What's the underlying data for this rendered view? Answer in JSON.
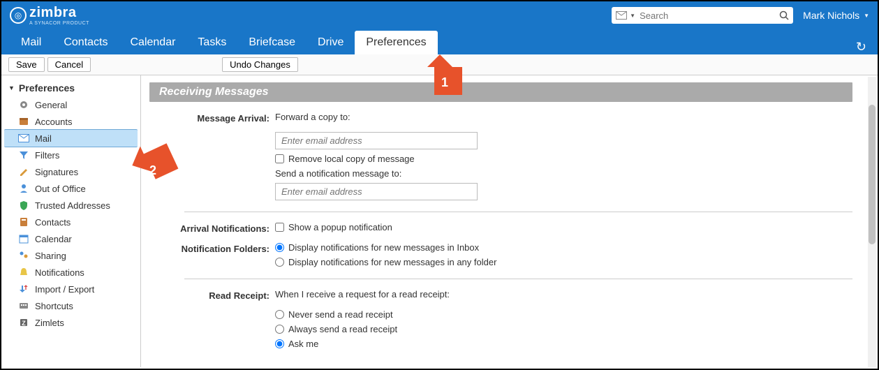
{
  "brand": {
    "name": "zimbra",
    "tagline": "A SYNACOR PRODUCT"
  },
  "search": {
    "placeholder": "Search"
  },
  "user": {
    "name": "Mark Nichols"
  },
  "nav": {
    "items": [
      "Mail",
      "Contacts",
      "Calendar",
      "Tasks",
      "Briefcase",
      "Drive",
      "Preferences"
    ],
    "active": "Preferences"
  },
  "toolbar": {
    "save": "Save",
    "cancel": "Cancel",
    "undo": "Undo Changes"
  },
  "sidebar": {
    "title": "Preferences",
    "items": [
      {
        "icon": "gear",
        "label": "General"
      },
      {
        "icon": "accounts",
        "label": "Accounts"
      },
      {
        "icon": "mail",
        "label": "Mail",
        "selected": true
      },
      {
        "icon": "filters",
        "label": "Filters"
      },
      {
        "icon": "signatures",
        "label": "Signatures"
      },
      {
        "icon": "outofoffice",
        "label": "Out of Office"
      },
      {
        "icon": "trusted",
        "label": "Trusted Addresses"
      },
      {
        "icon": "contacts",
        "label": "Contacts"
      },
      {
        "icon": "calendar",
        "label": "Calendar"
      },
      {
        "icon": "sharing",
        "label": "Sharing"
      },
      {
        "icon": "notifications",
        "label": "Notifications"
      },
      {
        "icon": "importexport",
        "label": "Import / Export"
      },
      {
        "icon": "shortcuts",
        "label": "Shortcuts"
      },
      {
        "icon": "zimlets",
        "label": "Zimlets"
      }
    ]
  },
  "section": {
    "title": "Receiving Messages",
    "messageArrival": {
      "label": "Message Arrival:",
      "forwardCopy": "Forward a copy to:",
      "forwardPlaceholder": "Enter email address",
      "removeLocal": "Remove local copy of message",
      "sendNotification": "Send a notification message to:",
      "notificationPlaceholder": "Enter email address"
    },
    "arrivalNotifications": {
      "label": "Arrival Notifications:",
      "popup": "Show a popup notification"
    },
    "notificationFolders": {
      "label": "Notification Folders:",
      "inbox": "Display notifications for new messages in Inbox",
      "anyFolder": "Display notifications for new messages in any folder"
    },
    "readReceipt": {
      "label": "Read Receipt:",
      "intro": "When I receive a request for a read receipt:",
      "never": "Never send a read receipt",
      "always": "Always send a read receipt",
      "ask": "Ask me"
    }
  },
  "annotations": {
    "one": "1",
    "two": "2"
  }
}
